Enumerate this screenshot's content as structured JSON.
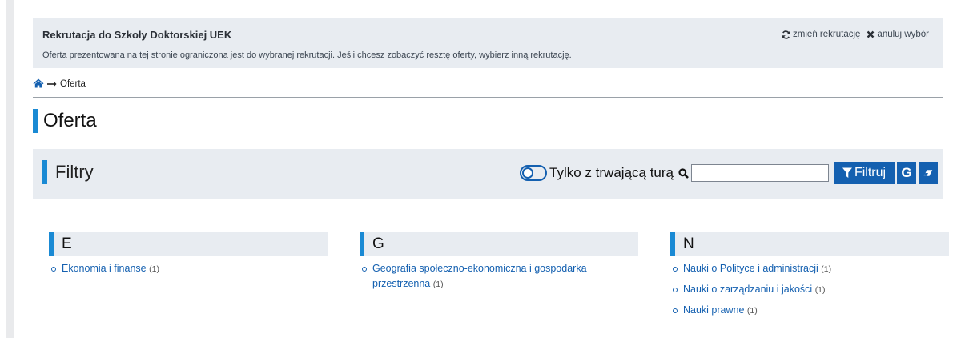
{
  "recruitment": {
    "title": "Rekrutacja do Szkoły Doktorskiej UEK",
    "note": "Oferta prezentowana na tej stronie ograniczona jest do wybranej rekrutacji. Jeśli chcesz zobaczyć resztę oferty, wybierz inną rekrutację.",
    "change_label": "zmień rekrutację",
    "cancel_label": "anuluj wybór"
  },
  "breadcrumb": {
    "current": "Oferta"
  },
  "page": {
    "title": "Oferta"
  },
  "filters": {
    "heading": "Filtry",
    "toggle_label": "Tylko z trwającą turą",
    "search_value": "",
    "filter_button": "Filtruj",
    "g_button": "G"
  },
  "groups": [
    {
      "letter": "E",
      "items": [
        {
          "label": "Ekonomia i finanse",
          "count": "(1)"
        }
      ]
    },
    {
      "letter": "G",
      "items": [
        {
          "label": "Geografia społeczno-ekonomiczna i gospodarka przestrzenna",
          "count": "(1)"
        }
      ]
    },
    {
      "letter": "N",
      "items": [
        {
          "label": "Nauki o Polityce i administracji",
          "count": "(1)"
        },
        {
          "label": "Nauki o zarządzaniu i jakości",
          "count": "(1)"
        },
        {
          "label": "Nauki prawne",
          "count": "(1)"
        }
      ]
    }
  ],
  "colors": {
    "accent": "#1a8ad4",
    "primary_button": "#1460b0",
    "panel_bg": "#e8ecf1"
  }
}
